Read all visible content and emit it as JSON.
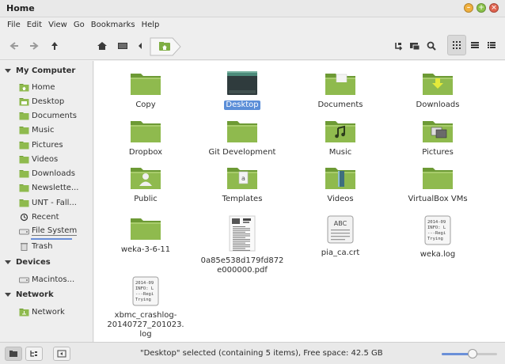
{
  "window": {
    "title": "Home"
  },
  "menu": [
    "File",
    "Edit",
    "View",
    "Go",
    "Bookmarks",
    "Help"
  ],
  "colors": {
    "folder": "#8fba4e",
    "folder_dark": "#6d9a35",
    "selection": "#5b8ed8",
    "close": "#e0624e",
    "minimize": "#f0b03e",
    "maximize": "#8bc34a"
  },
  "sidebar": {
    "sections": [
      {
        "title": "My Computer",
        "items": [
          {
            "label": "Home",
            "icon": "home-folder-icon"
          },
          {
            "label": "Desktop",
            "icon": "desktop-folder-icon"
          },
          {
            "label": "Documents",
            "icon": "folder-icon"
          },
          {
            "label": "Music",
            "icon": "folder-icon"
          },
          {
            "label": "Pictures",
            "icon": "folder-icon"
          },
          {
            "label": "Videos",
            "icon": "folder-icon"
          },
          {
            "label": "Downloads",
            "icon": "folder-icon"
          },
          {
            "label": "Newslette...",
            "icon": "folder-icon"
          },
          {
            "label": "UNT - Fall...",
            "icon": "folder-icon"
          },
          {
            "label": "Recent",
            "icon": "recent-icon"
          },
          {
            "label": "File System",
            "icon": "drive-icon"
          },
          {
            "label": "Trash",
            "icon": "trash-icon"
          }
        ]
      },
      {
        "title": "Devices",
        "items": [
          {
            "label": "Macintos...",
            "icon": "drive-icon"
          }
        ]
      },
      {
        "title": "Network",
        "items": [
          {
            "label": "Network",
            "icon": "network-icon"
          }
        ]
      }
    ]
  },
  "files": [
    {
      "label": "Copy",
      "icon": "folder"
    },
    {
      "label": "Desktop",
      "icon": "desktop-folder",
      "selected": true
    },
    {
      "label": "Documents",
      "icon": "documents-folder"
    },
    {
      "label": "Downloads",
      "icon": "downloads-folder"
    },
    {
      "label": "Dropbox",
      "icon": "folder"
    },
    {
      "label": "Git Development",
      "icon": "folder"
    },
    {
      "label": "Music",
      "icon": "music-folder"
    },
    {
      "label": "Pictures",
      "icon": "pictures-folder"
    },
    {
      "label": "Public",
      "icon": "public-folder"
    },
    {
      "label": "Templates",
      "icon": "templates-folder"
    },
    {
      "label": "Videos",
      "icon": "videos-folder"
    },
    {
      "label": "VirtualBox VMs",
      "icon": "folder"
    },
    {
      "label": "weka-3-6-11",
      "icon": "folder"
    },
    {
      "label": "0a85e538d179fd872\ne000000.pdf",
      "icon": "pdf-file"
    },
    {
      "label": "pia_ca.crt",
      "icon": "certificate-file"
    },
    {
      "label": "weka.log",
      "icon": "text-log-file"
    },
    {
      "label": "xbmc_crashlog-\n20140727_201023.\nlog",
      "icon": "text-log-file"
    }
  ],
  "status": {
    "text": "\"Desktop\" selected (containing 5 items), Free space: 42.5 GB",
    "zoom_fraction": 0.55
  },
  "icon_text": {
    "abc": "ABC",
    "log_line1": "2014-09",
    "log_line2": "INFO: L",
    "log_line3": "---Regi",
    "log_line4": "Trying"
  }
}
